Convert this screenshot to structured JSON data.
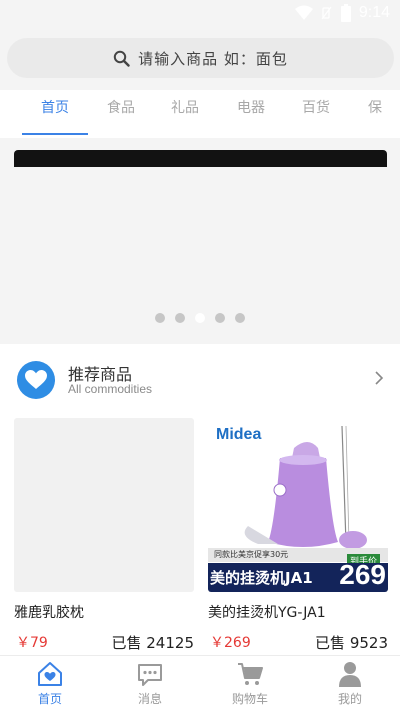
{
  "status_bar": {
    "time": "9:14"
  },
  "search": {
    "placeholder": "请输入商品 如：面包"
  },
  "tabs": [
    {
      "label": "首页",
      "active": true
    },
    {
      "label": "食品",
      "active": false
    },
    {
      "label": "礼品",
      "active": false
    },
    {
      "label": "电器",
      "active": false
    },
    {
      "label": "百货",
      "active": false
    },
    {
      "label": "保",
      "active": false
    }
  ],
  "banner": {
    "dots": 5,
    "active_dot": 3
  },
  "recommend": {
    "title": "推荐商品",
    "subtitle": "All commodities",
    "products": [
      {
        "name": "雅鹿乳胶枕",
        "price": "￥79",
        "sold": "已售 24125",
        "image": "blank"
      },
      {
        "name": "美的挂烫机YG-JA1",
        "price": "￥269",
        "sold": "已售 9523",
        "image": "steamer",
        "image_text": {
          "brand": "Midea",
          "promo_line": "同款比美京促享30元",
          "badge": "到手价",
          "headline": "美的挂烫机JA1",
          "price": "269"
        }
      }
    ]
  },
  "bottom_nav": [
    {
      "label": "首页",
      "icon": "home-heart-icon",
      "active": true
    },
    {
      "label": "消息",
      "icon": "chat-bubble-icon",
      "active": false
    },
    {
      "label": "购物车",
      "icon": "cart-icon",
      "active": false
    },
    {
      "label": "我的",
      "icon": "user-icon",
      "active": false
    }
  ],
  "colors": {
    "accent": "#3b82e6",
    "price": "#e53935",
    "background": "#f4f4f4"
  }
}
